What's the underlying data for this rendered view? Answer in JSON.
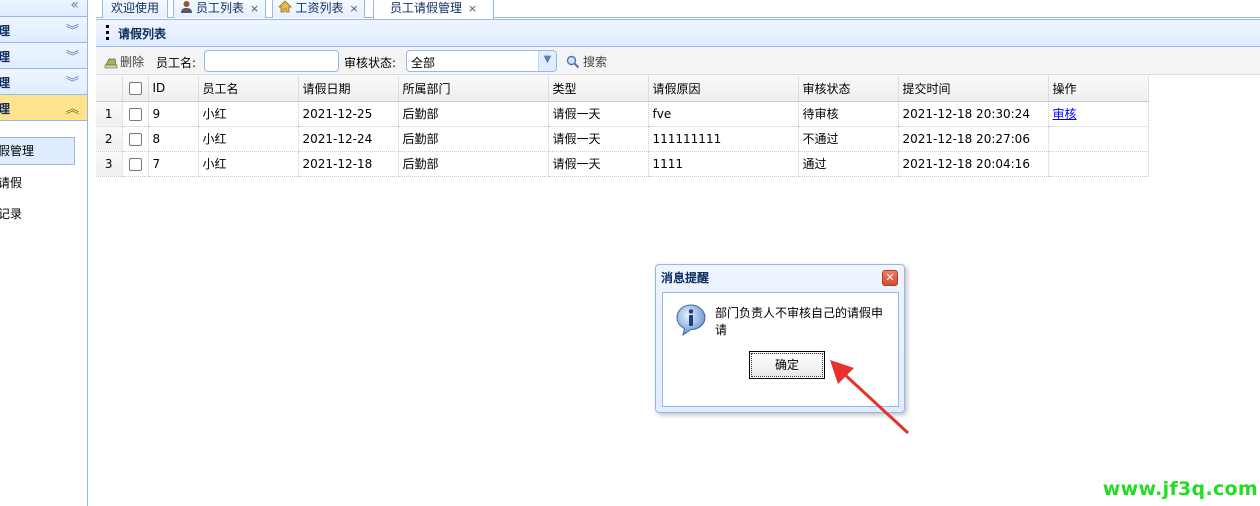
{
  "sidebar": {
    "collapse_icon": "double-chevron-left-icon",
    "panels": [
      {
        "label": "理",
        "state": "collapsed"
      },
      {
        "label": "理",
        "state": "collapsed"
      },
      {
        "label": "理",
        "state": "collapsed"
      },
      {
        "label": "理",
        "state": "expanded"
      }
    ],
    "items": [
      "假管理",
      "请假",
      "记录"
    ]
  },
  "tabs": [
    {
      "label": "欢迎使用",
      "closable": false
    },
    {
      "label": "员工列表",
      "icon": "user-icon",
      "closable": true
    },
    {
      "label": "工资列表",
      "icon": "home-icon",
      "closable": true
    },
    {
      "label": "员工请假管理",
      "closable": true,
      "active": true
    }
  ],
  "close_glyph": "×",
  "panel": {
    "title": "请假列表"
  },
  "toolbar": {
    "delete_label": "删除",
    "name_label": "员工名:",
    "name_value": "",
    "status_label": "审核状态:",
    "status_value": "全部",
    "search_label": "搜索"
  },
  "grid": {
    "columns": [
      "ID",
      "员工名",
      "请假日期",
      "所属部门",
      "类型",
      "请假原因",
      "审核状态",
      "提交时间",
      "操作"
    ],
    "rows": [
      {
        "num": "1",
        "id": "9",
        "name": "小红",
        "date": "2021-12-25",
        "dept": "后勤部",
        "type": "请假一天",
        "reason": "fve",
        "status": "待审核",
        "time": "2021-12-18 20:30:24",
        "action": "审核"
      },
      {
        "num": "2",
        "id": "8",
        "name": "小红",
        "date": "2021-12-24",
        "dept": "后勤部",
        "type": "请假一天",
        "reason": "111111111",
        "status": "不通过",
        "time": "2021-12-18 20:27:06",
        "action": ""
      },
      {
        "num": "3",
        "id": "7",
        "name": "小红",
        "date": "2021-12-18",
        "dept": "后勤部",
        "type": "请假一天",
        "reason": "1111",
        "status": "通过",
        "time": "2021-12-18 20:04:16",
        "action": ""
      }
    ]
  },
  "dialog": {
    "title": "消息提醒",
    "message": "部门负责人不审核自己的请假申请",
    "ok_label": "确定",
    "icon": "info-icon"
  },
  "annotation": {
    "color": "#e8312a"
  },
  "watermark": "www.jf3q.com",
  "colors": {
    "accent_border": "#95b8e7",
    "active_panel": "#ffe48d",
    "watermark": "#22dd22"
  }
}
